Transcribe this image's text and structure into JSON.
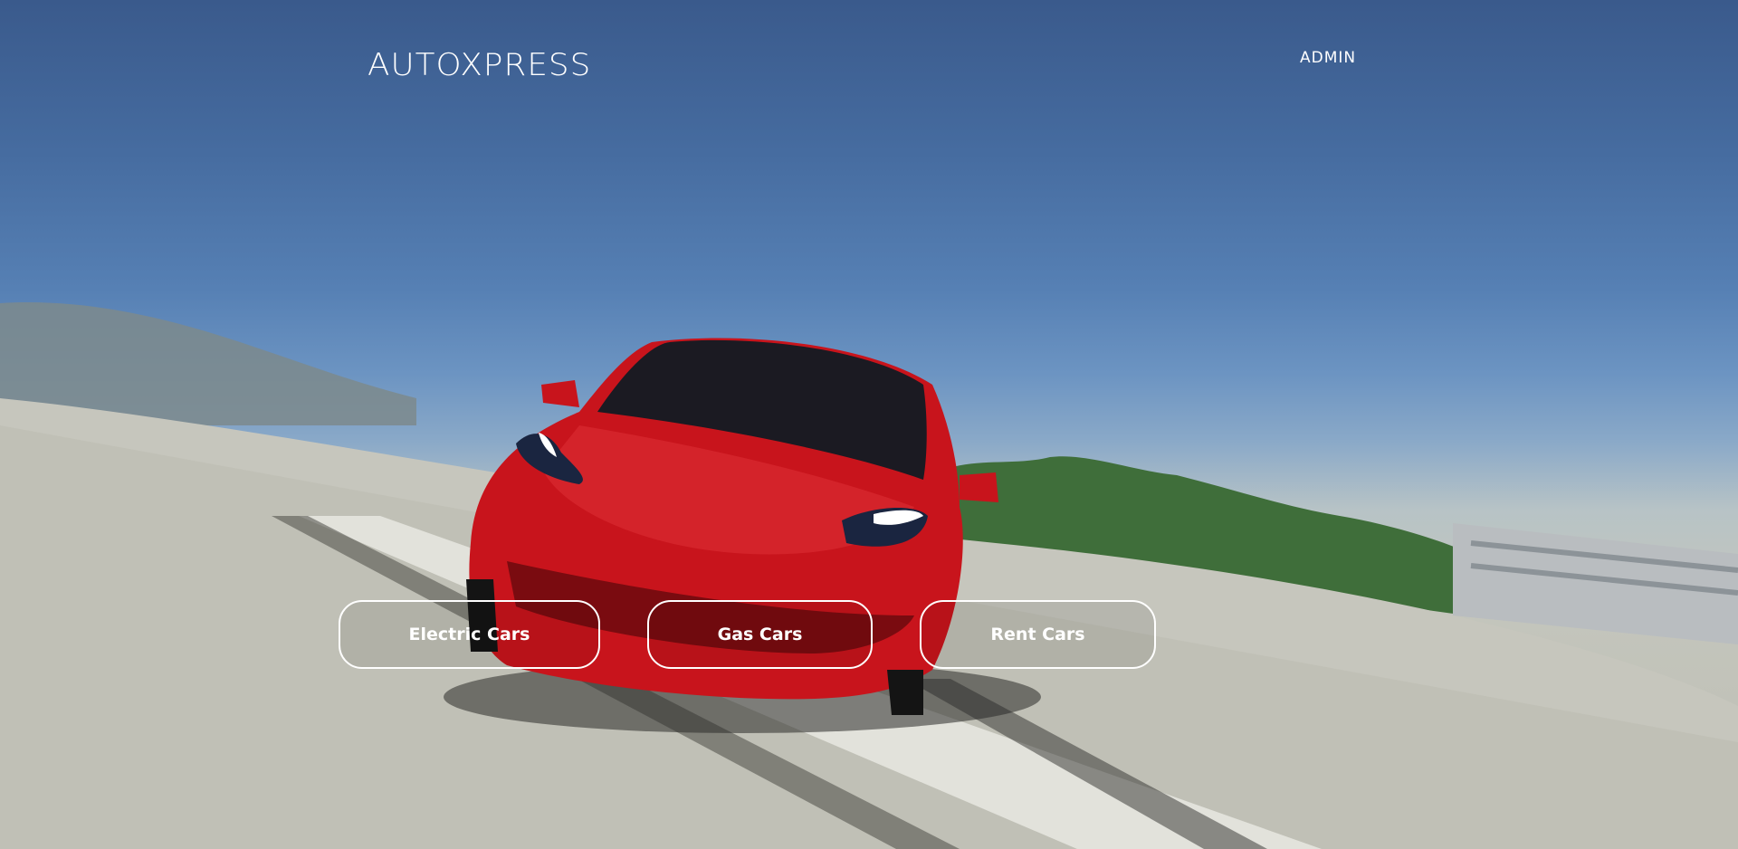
{
  "header": {
    "logo_text": "AUTOXPRESS",
    "admin_label": "ADMIN"
  },
  "categories": [
    {
      "label": "Electric Cars"
    },
    {
      "label": "Gas Cars"
    },
    {
      "label": "Rent Cars"
    }
  ],
  "colors": {
    "sky_top": "#3a5a8c",
    "sky_bottom": "#8aa9c8",
    "road": "#c2c2b8",
    "car_red": "#c8141c",
    "button_border": "#ffffff"
  }
}
